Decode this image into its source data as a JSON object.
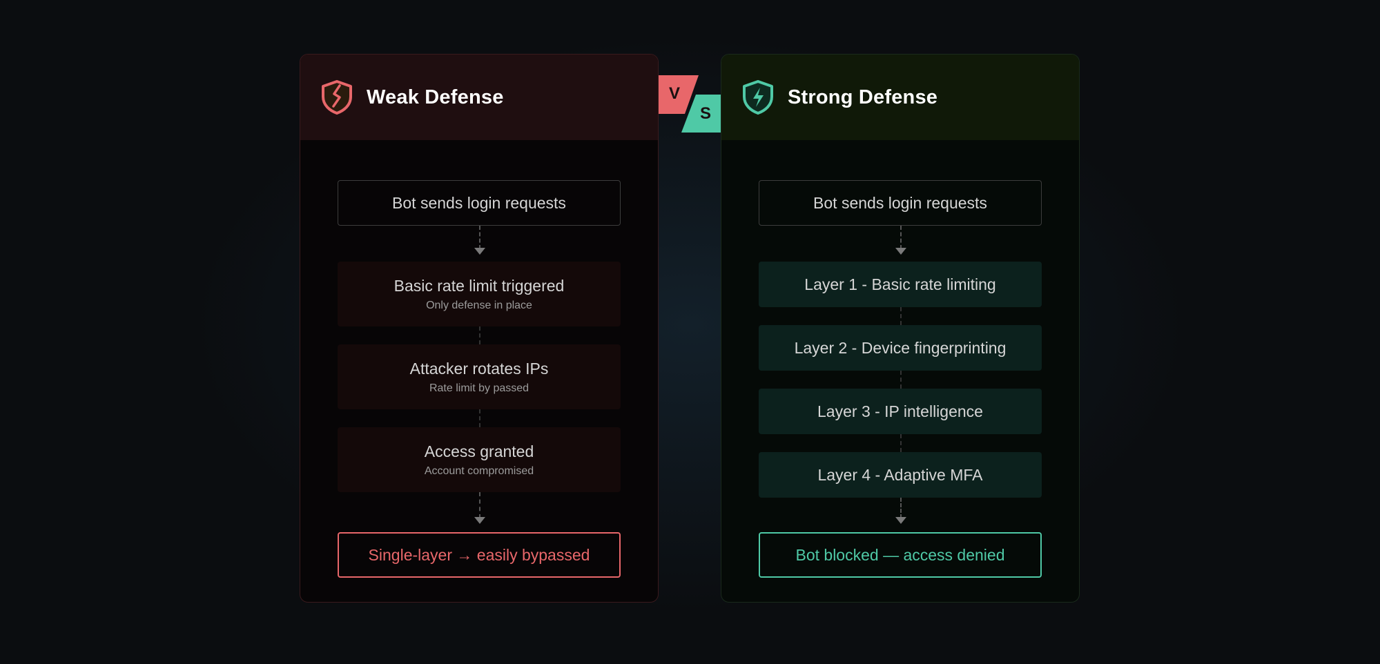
{
  "weak": {
    "title": "Weak Defense",
    "icon": "broken-shield-icon",
    "accent": "#e8676a",
    "start": "Bot sends login requests",
    "steps": [
      {
        "label": "Basic rate limit triggered",
        "sub": "Only defense in place"
      },
      {
        "label": "Attacker rotates IPs",
        "sub": "Rate limit by passed"
      },
      {
        "label": "Access granted",
        "sub": "Account compromised"
      }
    ],
    "result": "Single-layer → easily bypassed"
  },
  "strong": {
    "title": "Strong Defense",
    "icon": "lightning-shield-icon",
    "accent": "#4fc9a6",
    "start": "Bot sends login requests",
    "steps": [
      {
        "label": "Layer 1 - Basic rate limiting"
      },
      {
        "label": "Layer 2 - Device fingerprinting"
      },
      {
        "label": "Layer 3 - IP intelligence"
      },
      {
        "label": "Layer 4 - Adaptive MFA"
      }
    ],
    "result": "Bot blocked — access denied"
  },
  "vs": {
    "v": "V",
    "s": "S"
  }
}
